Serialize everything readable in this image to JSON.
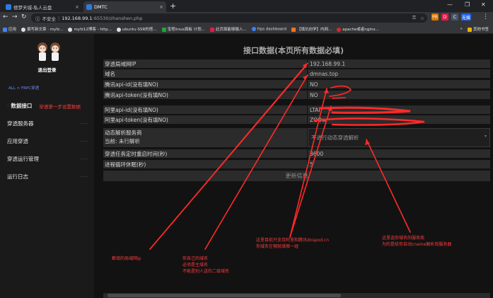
{
  "browser": {
    "tabs": [
      {
        "label": "德梦天城-私人云盘",
        "favicon_color": "#2d7be0",
        "active": false
      },
      {
        "label": "DMTC",
        "favicon_color": "#2d7be0",
        "active": true
      }
    ],
    "address": {
      "insecure_label": "不安全",
      "host": "192.168.99.1",
      "path": ":65530/zhanshen.php"
    },
    "bookmarks": [
      "应用",
      "撰写新文章 · myfz...",
      "myfz12博客 - http...",
      "ubuntu-SSR的搭...",
      "宝塔linux面板 计划...",
      "此页面能够输入...",
      "frps dashboard",
      "【填坑向学】内网...",
      "apache或者nginx...",
      "其他书签"
    ],
    "extensions": [
      {
        "label": "PR",
        "color": "#d97706"
      },
      {
        "label": "D",
        "color": "#e11d48"
      },
      {
        "label": "C",
        "color": "#475569"
      },
      {
        "label": "无痕",
        "color": "#2563eb"
      }
    ]
  },
  "sidebar": {
    "logout_label": "退出登录",
    "breadcrumb": "ALL > FRPC穿透",
    "items": [
      {
        "label": "数据接口",
        "hint": "穿透第一步设置数据"
      },
      {
        "label": "穿透服务器"
      },
      {
        "label": "应用穿透"
      },
      {
        "label": "穿透运行管理"
      },
      {
        "label": "运行日志"
      }
    ],
    "more_glyph": "·····"
  },
  "main": {
    "title": "接口数据(本页所有数据必填)",
    "rows": [
      {
        "label": "穿透局域网IP",
        "value": "192.168.99.1"
      },
      {
        "label": "域名",
        "value": "dmnas.top"
      },
      {
        "label": "腾讯api-id(没有填NO)",
        "value": "NO"
      },
      {
        "label": "腾讯api-token(没有填NO)",
        "value": "NO"
      },
      {
        "label": "阿里api-id(没有填NO)",
        "value": "LTAI"
      },
      {
        "label": "阿里api-token(没有填NO)",
        "value": "ZOOw"
      }
    ],
    "ddns": {
      "label_line1": "动态解析服务商",
      "label_line2": "当前: 未行解析",
      "selected": "不进行动态穿透解析"
    },
    "rows2": [
      {
        "label": "穿透任务定时重启时间(秒)",
        "value": "3600"
      },
      {
        "label": "进程循环休眠(秒)",
        "value": "5"
      }
    ],
    "update_button": "更新信息"
  },
  "annotations": {
    "lan_ip": "都填的局域网ip",
    "domain_1": "你自己的域名",
    "domain_2": "必须是主域名",
    "domain_3": "不能是别人送的二级域名",
    "api_1": "这里目前只支持阿里和腾讯dnspod.cn",
    "api_2": "你域名在哪就填哪一组",
    "ddns_1": "这里选你域名的服务商",
    "ddns_2": "为的是给你自动cname解析到服务器"
  },
  "colors": {
    "annotation": "#ff3b3b",
    "accent_link": "#6f8bff"
  }
}
